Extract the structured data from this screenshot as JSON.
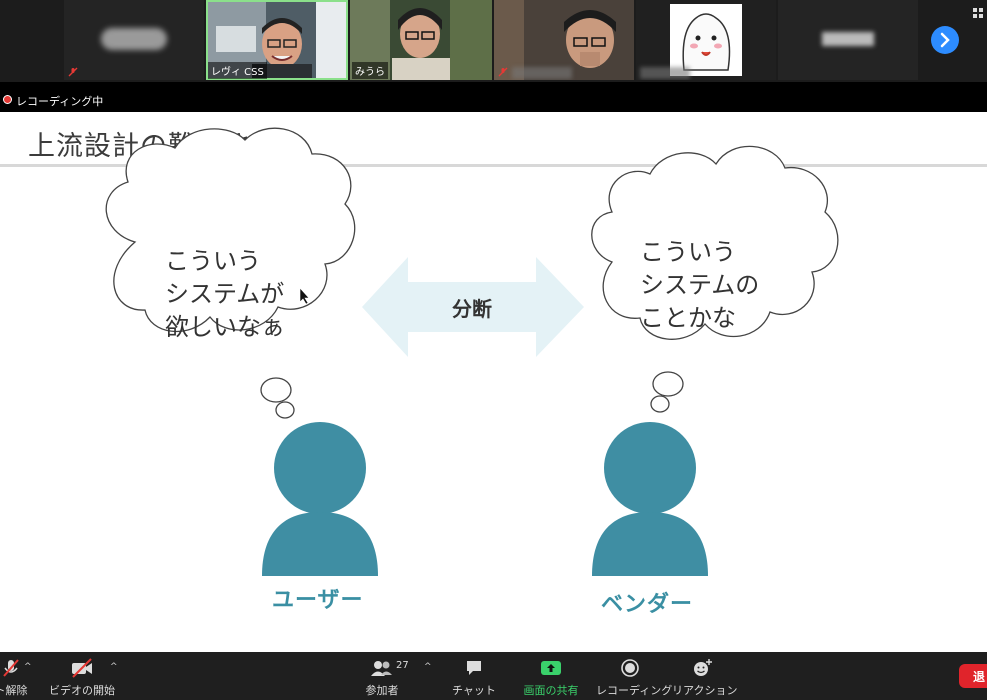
{
  "participants": [
    {
      "name": "",
      "muted": true
    },
    {
      "name": "レヴィ CSS",
      "muted": false
    },
    {
      "name": "みうら",
      "muted": false
    },
    {
      "name": "",
      "muted": true
    },
    {
      "name": "",
      "muted": false
    },
    {
      "name": "",
      "muted": false
    }
  ],
  "recording": {
    "label": "レコーディング中"
  },
  "slide": {
    "title": "上流設計の難しさ",
    "left_bubble": "こういう\nシステムが\n欲しいなぁ",
    "right_bubble": "こういう\nシステムの\nことかな",
    "arrow_label": "分断",
    "left_person": "ユーザー",
    "right_person": "ベンダー"
  },
  "toolbar": {
    "mute_label": "ト解除",
    "video_label": "ビデオの開始",
    "participants_label": "参加者",
    "participants_count": "27",
    "chat_label": "チャット",
    "share_label": "画面の共有",
    "record_label": "レコーディング",
    "reactions_label": "リアクション",
    "leave_label": "退"
  },
  "colors": {
    "accent_teal": "#3f8ea3",
    "share_green": "#3ad16b",
    "arrow_fill": "#e4f2f6",
    "leave_red": "#e0242b"
  }
}
